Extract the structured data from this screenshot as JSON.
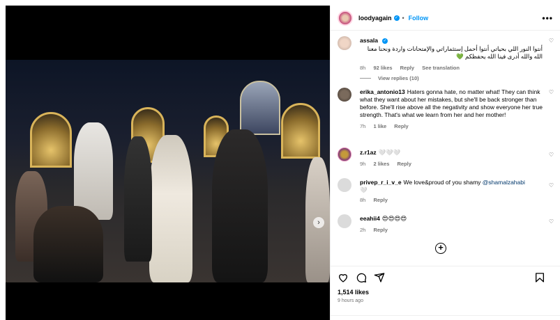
{
  "post": {
    "username": "loodyagain",
    "follow_label": "Follow",
    "dot": "•",
    "more_label": "•••",
    "likes": "1,514 likes",
    "time_ago": "9 hours ago",
    "carousel_next": "›"
  },
  "comments": [
    {
      "username": "assala",
      "verified": true,
      "text": "أنتوا النور اللي بحياتي أنتوا أحمل إستثماراتي والإمتحانات واردة ونحنا معنا الله والله أدرى فينا الله يحفظكم",
      "emoji": "💚",
      "time": "8h",
      "likes": "92 likes",
      "reply": "Reply",
      "extra": "See translation",
      "view_replies": "View replies (10)"
    },
    {
      "username": "erika_antonio13",
      "text": "Haters gonna hate, no matter what! They can think what they want about her mistakes, but she'll be back stronger than before. She'll rise above all the negativity and show everyone her true strength. That's what we learn from her and her mother!",
      "time": "7h",
      "likes": "1 like",
      "reply": "Reply"
    },
    {
      "username": "z.r1az",
      "text": "🤍🤍🤍",
      "time": "9h",
      "likes": "2 likes",
      "reply": "Reply"
    },
    {
      "username": "privep_r_i_v_e",
      "text": "We love&proud of you shamy",
      "mention": "@shamalzahabi",
      "emoji": "🤍",
      "time": "8h",
      "reply": "Reply"
    },
    {
      "username": "eeahii4",
      "text": "😍😍😍😍",
      "time": "2h",
      "reply": "Reply"
    }
  ],
  "icons": {
    "like": "heart-icon",
    "comment": "comment-icon",
    "share": "share-icon",
    "save": "bookmark-icon",
    "add": "add-circle-icon"
  },
  "colors": {
    "accent": "#0095f6",
    "secondary_text": "#737373",
    "background": "#ffffff"
  }
}
